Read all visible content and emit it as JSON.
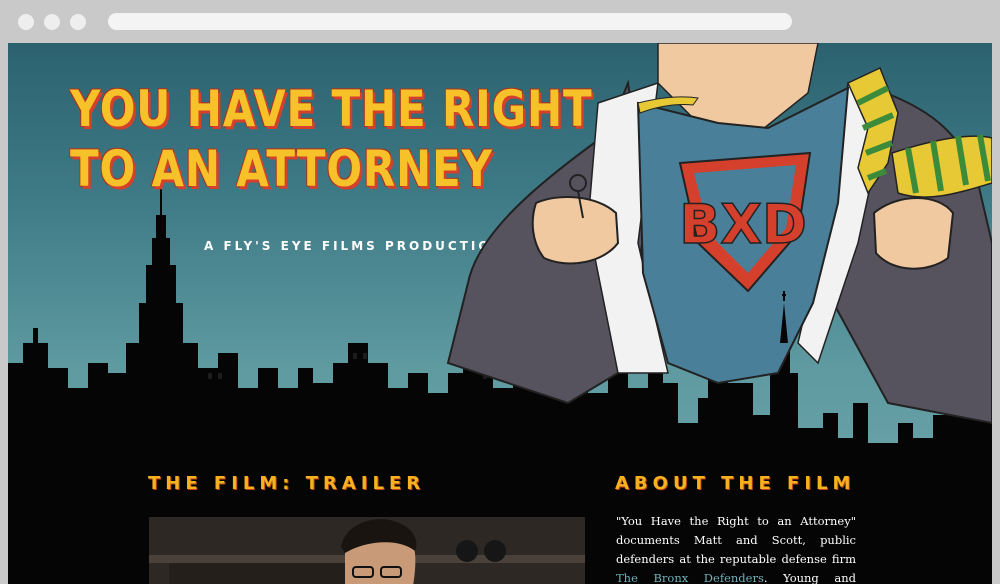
{
  "hero": {
    "title_line1": "YOU HAVE THE RIGHT",
    "title_line2": "TO AN ATTORNEY",
    "tagline": "A FLY'S EYE FILMS PRODUCTION",
    "logo_text": "BXD"
  },
  "trailer": {
    "heading": "THE FILM: TRAILER"
  },
  "about": {
    "heading": "ABOUT THE FILM",
    "text_before": "\"You Have the Right to an Attorney\" documents Matt and Scott, public defenders at the reputable defense firm ",
    "link": "The Bronx Defenders",
    "text_after": ". Young and idealistic, Matt and"
  },
  "colors": {
    "accent_gold": "#f6b21e",
    "title_red": "#d4402b",
    "link_teal": "#6fb0b8",
    "sky": "#3e7a86"
  }
}
